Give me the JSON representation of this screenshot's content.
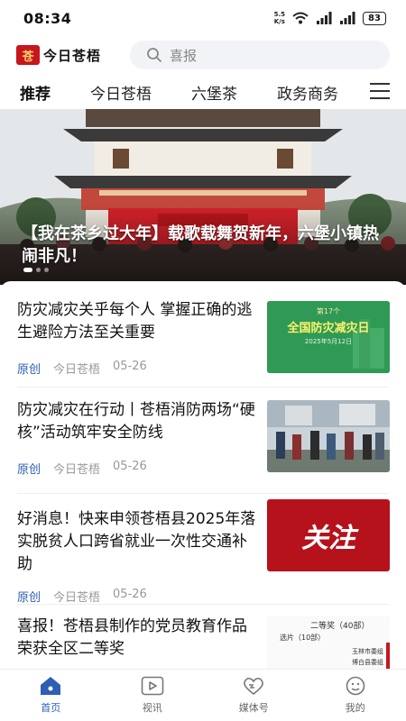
{
  "status_bar": {
    "time": "08:34",
    "net_speed_value": "5.5",
    "net_speed_unit": "K/s",
    "battery": "83"
  },
  "header": {
    "logo_mark": "苍",
    "logo_text": "今日苍梧",
    "search_placeholder": "喜报",
    "search_icon": "search-icon"
  },
  "tabs": [
    {
      "label": "推荐",
      "active": true
    },
    {
      "label": "今日苍梧",
      "active": false
    },
    {
      "label": "六堡茶",
      "active": false
    },
    {
      "label": "政务商务",
      "active": false
    }
  ],
  "banner": {
    "title": "【我在茶乡过大年】载歌载舞贺新年，六堡小镇热闹非凡！",
    "slide_index": 1,
    "slide_count": 3
  },
  "articles": [
    {
      "title": "防灾减灾关乎每个人 掌握正确的逃生避险方法至关重要",
      "tag": "原创",
      "source": "今日苍梧",
      "date": "05-26",
      "thumb_caption": "全国防灾减灾日",
      "thumb_top": "第17个",
      "thumb_sub": "2025年5月12日",
      "thumb_color": "#2f9a55"
    },
    {
      "title": "防灾减灾在行动丨苍梧消防两场“硬核”活动筑牢安全防线",
      "tag": "原创",
      "source": "今日苍梧",
      "date": "05-26",
      "thumb_color": "#8a9aa6"
    },
    {
      "title": "好消息！快来申领苍梧县2025年落实脱贫人口跨省就业一次性交通补助",
      "tag": "原创",
      "source": "今日苍梧",
      "date": "05-26",
      "thumb_caption": "关注",
      "thumb_color": "#b5121b"
    },
    {
      "title": "喜报！苍梧县制作的党员教育作品荣获全区二等奖",
      "thumb_heading": "二等奖（40部）",
      "thumb_line1": "选片（10部）",
      "thumb_line2": "玉林市委组",
      "thumb_line3": "博白县委组"
    }
  ],
  "bottom_nav": [
    {
      "label": "首页",
      "icon": "home-icon",
      "active": true
    },
    {
      "label": "视讯",
      "icon": "video-icon",
      "active": false
    },
    {
      "label": "媒体号",
      "icon": "media-icon",
      "active": false
    },
    {
      "label": "我的",
      "icon": "profile-icon",
      "active": false
    }
  ],
  "colors": {
    "accent": "#2e5fb3",
    "brand_red": "#c8161d"
  }
}
